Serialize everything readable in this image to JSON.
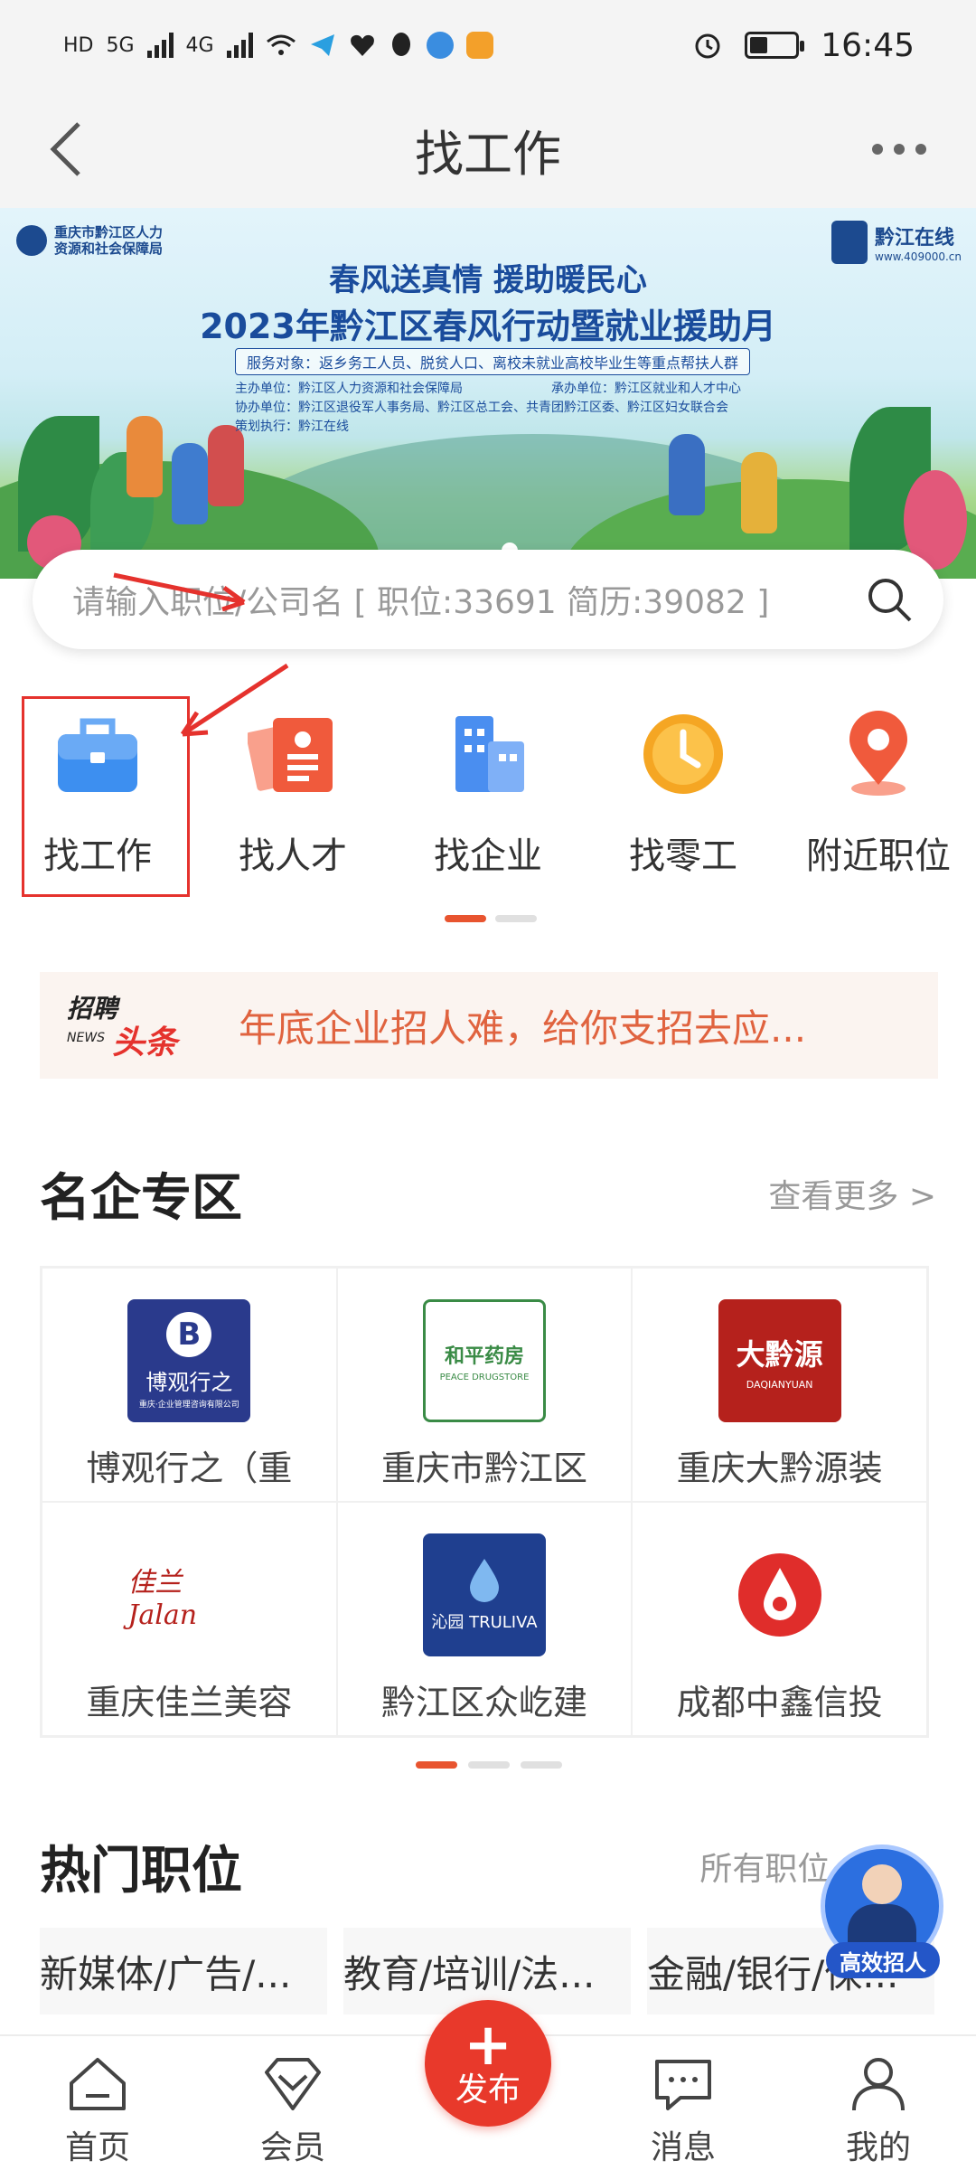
{
  "status_bar": {
    "left_labels": [
      "HD",
      "5G",
      "4G"
    ],
    "time": "16:45",
    "battery_level": 0.35
  },
  "nav": {
    "title": "找工作",
    "back_icon": "chevron-left-icon",
    "more_icon": "more-dots-icon"
  },
  "banner": {
    "org": [
      "重庆市黔江区人力",
      "资源和社会保障局"
    ],
    "brand_name": "黔江在线",
    "brand_url": "www.409000.cn",
    "line1": "春风送真情  援助暖民心",
    "line2": "2023年黔江区春风行动暨就业援助月",
    "line3": "服务对象：返乡务工人员、脱贫人口、离校未就业高校毕业生等重点帮扶人群",
    "info_left": [
      "主办单位：黔江区人力资源和社会保障局",
      "协办单位：黔江区退役军人事务局、黔江区总工会、共青团黔江区委、黔江区妇女联合会",
      "策划执行：黔江在线"
    ],
    "info_right": [
      "承办单位：黔江区就业和人才中心"
    ]
  },
  "search": {
    "placeholder": "请输入职位/公司名  [ 职位:33691  简历:39082 ]",
    "icon": "search-icon"
  },
  "quick_menu": [
    {
      "label": "找工作",
      "icon": "briefcase-icon",
      "color": "#3d8ff0"
    },
    {
      "label": "找人才",
      "icon": "resume-icon",
      "color": "#f05a3c"
    },
    {
      "label": "找企业",
      "icon": "building-icon",
      "color": "#4a8ef0"
    },
    {
      "label": "找零工",
      "icon": "clock-icon",
      "color": "#f5a623"
    },
    {
      "label": "附近职位",
      "icon": "location-pin-icon",
      "color": "#f05a3c"
    }
  ],
  "headline": {
    "badge_top": "招聘",
    "badge_mid": "头条",
    "badge_sub": "NEWS",
    "text": "年底企业招人难，给你支招去应..."
  },
  "famous": {
    "title": "名企专区",
    "more": "查看更多 >",
    "companies": [
      {
        "name": "博观行之（重",
        "logo_text": "博观行之",
        "logo_sub": "重庆·企业管理咨询有限公司",
        "logo_bg": "#2a3a8c"
      },
      {
        "name": "重庆市黔江区",
        "logo_text": "和平药房",
        "logo_sub": "PEACE DRUGSTORE",
        "logo_bg": "#ffffff"
      },
      {
        "name": "重庆大黔源装",
        "logo_text": "大黔源",
        "logo_sub": "DAQIANYUAN",
        "logo_bg": "#b5211c"
      },
      {
        "name": "重庆佳兰美容",
        "logo_text": "佳兰 Jalan",
        "logo_sub": "",
        "logo_bg": "#ffffff"
      },
      {
        "name": "黔江区众屹建",
        "logo_text": "沁园 TRULIVA",
        "logo_sub": "",
        "logo_bg": "#1f3f8f"
      },
      {
        "name": "成都中鑫信投",
        "logo_text": "",
        "logo_sub": "",
        "logo_bg": "#ffffff"
      }
    ]
  },
  "hot": {
    "title": "热门职位",
    "more": "所有职位 >",
    "jobs": [
      "新媒体/广告/...",
      "教育/培训/法...",
      "金融/银行/保..."
    ]
  },
  "float_badge": {
    "label": "高效招人"
  },
  "tabbar": {
    "items": [
      {
        "label": "首页",
        "icon": "home-icon"
      },
      {
        "label": "会员",
        "icon": "member-diamond-icon"
      },
      {
        "label": "消息",
        "icon": "message-icon"
      },
      {
        "label": "我的",
        "icon": "profile-icon"
      }
    ],
    "publish_label": "发布",
    "publish_plus": "+"
  }
}
